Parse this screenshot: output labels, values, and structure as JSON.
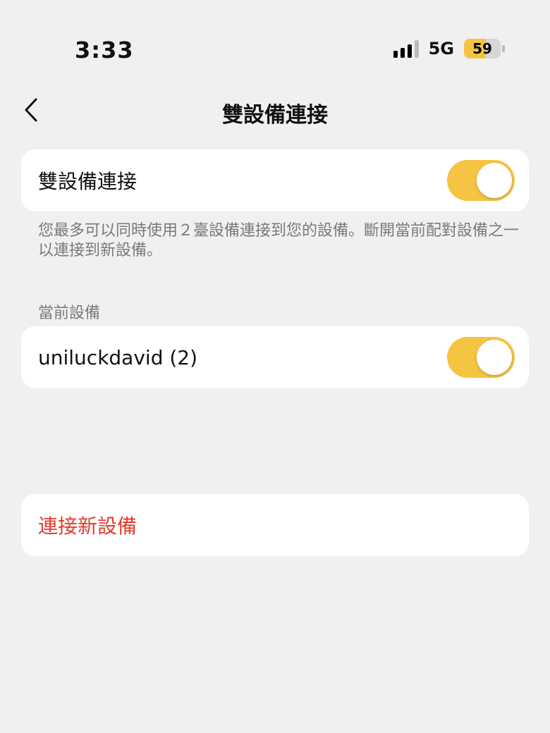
{
  "status_bar": {
    "time": "3:33",
    "network": "5G",
    "battery": "59",
    "battery_level": 0.59,
    "signal_bars_active": 3,
    "signal_bars_total": 4
  },
  "nav": {
    "back_icon": "chevron-left-icon",
    "title": "雙設備連接"
  },
  "dual_connect": {
    "label": "雙設備連接",
    "enabled": true,
    "description": "您最多可以同時使用２臺設備連接到您的設備。斷開當前配對設備之一以連接到新設備。"
  },
  "current_devices": {
    "header": "當前設備",
    "items": [
      {
        "name": "uniluckdavid (2)",
        "connected": true
      }
    ]
  },
  "connect_new": {
    "label": "連接新設備"
  },
  "colors": {
    "background": "#F0F0F0",
    "card": "#FFFFFF",
    "accent": "#F5C443",
    "danger": "#E53B2C",
    "secondary_text": "#7A7A7A"
  }
}
